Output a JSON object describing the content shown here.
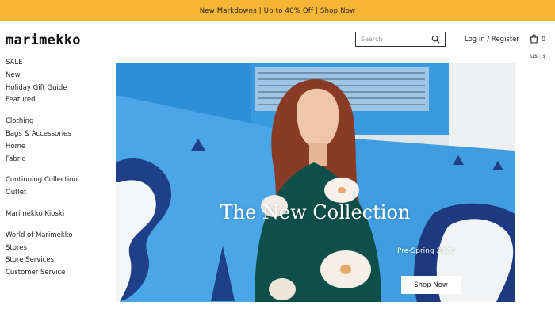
{
  "promo_banner": {
    "text": "New Markdowns | Up to 40% Off | Shop Now",
    "background": "#f7b535"
  },
  "header": {
    "logo": "marimekko",
    "search": {
      "placeholder": "Search",
      "icon": "search-icon"
    },
    "login": "Log in",
    "separator": "/",
    "register": "Register",
    "bag": {
      "icon": "shopping-bag-icon",
      "count": "0"
    },
    "locale": {
      "country": "US",
      "separator": "|",
      "currency": "$"
    }
  },
  "nav": {
    "group1": [
      {
        "label": "SALE"
      },
      {
        "label": "New"
      },
      {
        "label": "Holiday Gift Guide"
      },
      {
        "label": "Featured"
      }
    ],
    "group2": [
      {
        "label": "Clothing"
      },
      {
        "label": "Bags & Accessories"
      },
      {
        "label": "Home"
      },
      {
        "label": "Fabric"
      }
    ],
    "group3": [
      {
        "label": "Continuing Collection"
      },
      {
        "label": "Outlet"
      }
    ],
    "group4": [
      {
        "label": "Marimekko Kioski"
      }
    ],
    "group5": [
      {
        "label": "World of Marimekko"
      },
      {
        "label": "Stores"
      },
      {
        "label": "Store Services"
      },
      {
        "label": "Customer Service"
      }
    ]
  },
  "hero": {
    "title": "The New Collection",
    "subtitle": "Pre-Spring 2020",
    "button": "Shop Now"
  }
}
